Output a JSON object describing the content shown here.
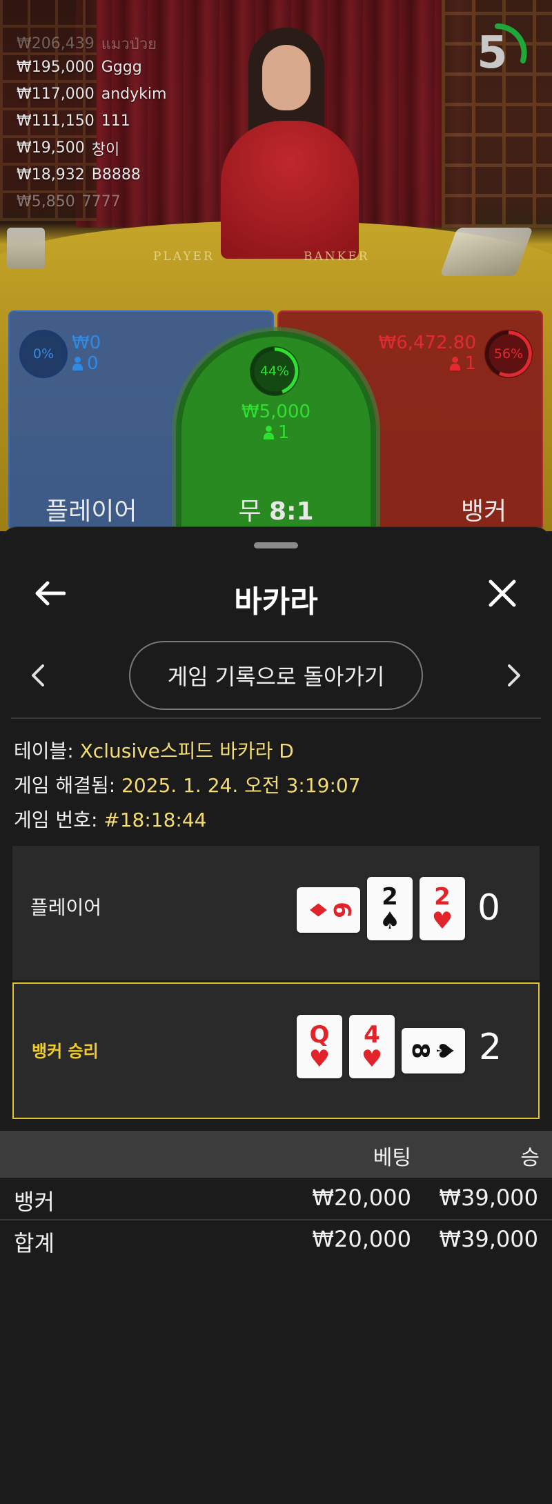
{
  "stream": {
    "timer_value": "5",
    "felt_player": "PLAYER",
    "felt_banker": "BANKER",
    "leaderboard": [
      {
        "amount": "₩206,439",
        "name": "แมวป่วย"
      },
      {
        "amount": "₩195,000",
        "name": "Gggg"
      },
      {
        "amount": "₩117,000",
        "name": "andykim"
      },
      {
        "amount": "₩111,150",
        "name": "111"
      },
      {
        "amount": "₩19,500",
        "name": "창이"
      },
      {
        "amount": "₩18,932",
        "name": "B8888"
      },
      {
        "amount": "₩5,850",
        "name": "7777"
      }
    ]
  },
  "bet_areas": {
    "player": {
      "label": "플레이어",
      "percent": "0%",
      "amount": "₩0",
      "players": "0",
      "color": "#2f8ae6"
    },
    "tie": {
      "label": "무",
      "payout": "8:1",
      "percent": "44%",
      "amount": "₩5,000",
      "players": "1",
      "color": "#2ee030"
    },
    "banker": {
      "label": "뱅커",
      "percent": "56%",
      "amount": "₩6,472.80",
      "players": "1",
      "color": "#e22a30"
    }
  },
  "sheet": {
    "title": "바카라",
    "back_icon": "arrow-left-icon",
    "close_icon": "close-icon",
    "history_button": "게임 기록으로 돌아가기",
    "info": {
      "table_label": "테이블:",
      "table_value": "Xclusive스피드 바카라 D",
      "resolved_label": "게임 해결됨:",
      "resolved_value": "2025. 1. 24. 오전 3:19:07",
      "round_label": "게임 번호:",
      "round_value": "#18:18:44"
    },
    "hands": {
      "player": {
        "label": "플레이어",
        "score": "0",
        "cards": [
          {
            "rank": "6",
            "suit": "♦",
            "color": "red",
            "orientation": "horizontal"
          },
          {
            "rank": "2",
            "suit": "♠",
            "color": "black",
            "orientation": "vertical"
          },
          {
            "rank": "2",
            "suit": "♥",
            "color": "red",
            "orientation": "vertical"
          }
        ]
      },
      "banker": {
        "label": "뱅커 승리",
        "score": "2",
        "cards": [
          {
            "rank": "Q",
            "suit": "♥",
            "color": "red",
            "orientation": "vertical"
          },
          {
            "rank": "4",
            "suit": "♥",
            "color": "red",
            "orientation": "vertical"
          },
          {
            "rank": "8",
            "suit": "♠",
            "color": "black",
            "orientation": "horizontal"
          }
        ]
      }
    },
    "bets_table": {
      "headers": {
        "bet": "베팅",
        "win": "승"
      },
      "rows": [
        {
          "name": "뱅커",
          "bet": "₩20,000",
          "win": "₩39,000"
        },
        {
          "name": "합계",
          "bet": "₩20,000",
          "win": "₩39,000"
        }
      ]
    }
  }
}
